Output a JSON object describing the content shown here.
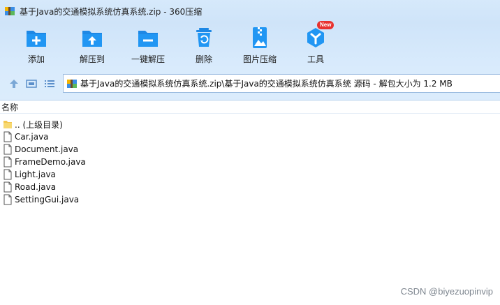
{
  "window": {
    "title": "基于Java的交通模拟系统仿真系统.zip - 360压缩",
    "app_icon": "archive-icon"
  },
  "toolbar": {
    "items": [
      {
        "label": "添加",
        "icon": "add-folder-icon"
      },
      {
        "label": "解压到",
        "icon": "extract-to-icon"
      },
      {
        "label": "一键解压",
        "icon": "one-click-extract-icon"
      },
      {
        "label": "删除",
        "icon": "trash-icon"
      },
      {
        "label": "图片压缩",
        "icon": "image-compress-icon"
      },
      {
        "label": "工具",
        "icon": "tools-icon",
        "badge": "New"
      }
    ]
  },
  "address_bar": {
    "path": "基于Java的交通模拟系统仿真系统.zip\\基于Java的交通模拟系统仿真系统 源码 - 解包大小为 1.2 MB"
  },
  "file_list": {
    "column_name": "名称",
    "items": [
      {
        "name": ".. (上级目录)",
        "type": "folder"
      },
      {
        "name": "Car.java",
        "type": "file"
      },
      {
        "name": "Document.java",
        "type": "file"
      },
      {
        "name": "FrameDemo.java",
        "type": "file"
      },
      {
        "name": "Light.java",
        "type": "file"
      },
      {
        "name": "Road.java",
        "type": "file"
      },
      {
        "name": "SettingGui.java",
        "type": "file"
      }
    ]
  },
  "watermark": "CSDN @biyezuopinvip",
  "colors": {
    "toolbar_bg": "#cfe4f9",
    "icon_blue": "#1e88e5",
    "badge_red": "#e8322f"
  }
}
